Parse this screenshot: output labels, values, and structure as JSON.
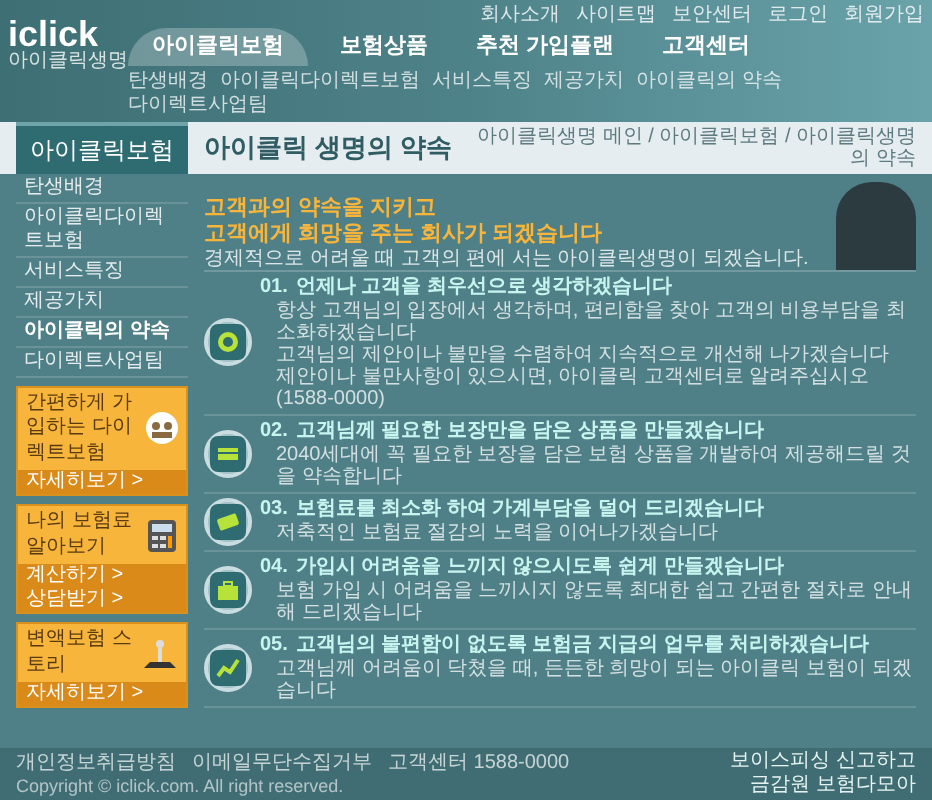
{
  "header": {
    "logo": "iclick",
    "logo_sub": "아이클릭생명",
    "nav": [
      {
        "label": "아이클릭보험",
        "selected": true
      },
      {
        "label": "보험상품",
        "selected": false
      },
      {
        "label": "추천 가입플랜",
        "selected": false
      },
      {
        "label": "고객센터",
        "selected": false
      }
    ],
    "top_links": [
      "회사소개",
      "사이트맵",
      "보안센터",
      "로그인",
      "회원가입"
    ],
    "sub_nav": [
      "탄생배경",
      "아이클릭다이렉트보험",
      "서비스특징",
      "제공가치",
      "아이클릭의 약속",
      "다이렉트사업팀"
    ]
  },
  "sidebar": {
    "title": "아이클릭보험",
    "items": [
      {
        "label": "탄생배경",
        "selected": false
      },
      {
        "label": "아이클릭다이렉트보험",
        "selected": false
      },
      {
        "label": "서비스특징",
        "selected": false
      },
      {
        "label": "제공가치",
        "selected": false
      },
      {
        "label": "아이클릭의 약속",
        "selected": true
      },
      {
        "label": "다이렉트사업팀",
        "selected": false
      }
    ],
    "banners": [
      {
        "title": "간편하게 가입하는 다이렉트보험",
        "links": [
          "자세히보기 >"
        ]
      },
      {
        "title": "나의 보험료 알아보기",
        "links": [
          "계산하기 >",
          "상담받기 >"
        ]
      },
      {
        "title": "변액보험 스토리",
        "links": [
          "자세히보기 >"
        ]
      }
    ]
  },
  "main": {
    "title": "아이클릭 생명의 약속",
    "breadcrumb": "아이클릭생명 메인 / 아이클릭보험 / 아이클릭생명의 약속",
    "hero": {
      "lines": [
        "고객과의 약속을 지키고",
        "고객에게 희망을 주는 회사가 되겠습니다"
      ],
      "text": "경제적으로 어려울 때 고객의 편에 서는 아이클릭생명이 되겠습니다."
    },
    "promises": [
      {
        "number": "01.",
        "title": "언제나 고객을 최우선으로 생각하겠습니다",
        "bullets": [
          "항상 고객님의 입장에서 생각하며, 편리함을 찾아 고객의 비용부담을 최소화하겠습니다",
          "고객님의 제안이나 불만을 수렴하여 지속적으로 개선해 나가겠습니다",
          "제안이나 불만사항이 있으시면, 아이클릭 고객센터로 알려주십시오 (1588-0000)"
        ]
      },
      {
        "number": "02.",
        "title": "고객님께 필요한 보장만을 담은 상품을 만들겠습니다",
        "bullets": [
          "2040세대에 꼭 필요한 보장을 담은 보험 상품을 개발하여 제공해드릴 것을 약속합니다"
        ]
      },
      {
        "number": "03.",
        "title": "보험료를 최소화 하여 가계부담을 덜어 드리겠습니다",
        "bullets": [
          "저축적인 보험료 절감의 노력을 이어나가겠습니다"
        ]
      },
      {
        "number": "04.",
        "title": "가입시 어려움을 느끼지 않으시도록 쉽게 만들겠습니다",
        "bullets": [
          "보험 가입 시 어려움을 느끼시지 않도록 최대한 쉽고 간편한 절차로 안내해 드리겠습니다"
        ]
      },
      {
        "number": "05.",
        "title": "고객님의 불편함이 없도록 보험금 지급의 업무를 처리하겠습니다",
        "bullets": [
          "고객님께 어려움이 닥쳤을 때, 든든한 희망이 되는 아이클릭 보험이 되겠습니다"
        ]
      }
    ]
  },
  "footer": {
    "links": [
      "개인정보취급방침",
      "이메일무단수집거부",
      "고객센터 1588-0000"
    ],
    "copyright": "Copyright © iclick.com. All right reserved.",
    "right_links": [
      "보이스피싱 신고하고",
      "금감원 보험다모아"
    ]
  }
}
